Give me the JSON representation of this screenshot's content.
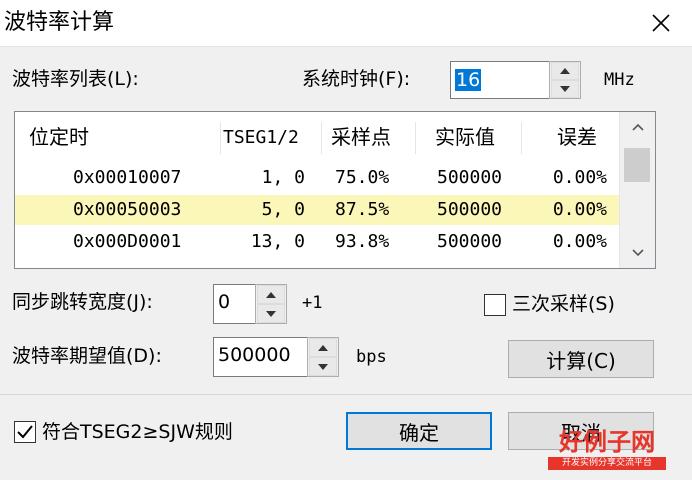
{
  "window": {
    "title": "波特率计算"
  },
  "list_label": "波特率列表(L):",
  "sysclock": {
    "label": "系统时钟(F):",
    "value": "16",
    "unit": "MHz"
  },
  "table": {
    "headers": [
      "位定时",
      "TSEG1/2",
      "采样点",
      "实际值",
      "误差"
    ],
    "rows": [
      {
        "timing": "0x00010007",
        "tseg": "1, 0",
        "sample": "75.0%",
        "actual": "500000",
        "error": "0.00%"
      },
      {
        "timing": "0x00050003",
        "tseg": "5, 0",
        "sample": "87.5%",
        "actual": "500000",
        "error": "0.00%"
      },
      {
        "timing": "0x000D0001",
        "tseg": "13, 0",
        "sample": "93.8%",
        "actual": "500000",
        "error": "0.00%"
      }
    ],
    "selected_index": 1
  },
  "sjw": {
    "label": "同步跳转宽度(J):",
    "value": "0",
    "suffix": "+1"
  },
  "triple_sample": {
    "label": "三次采样(S)",
    "checked": false
  },
  "baud": {
    "label": "波特率期望值(D):",
    "value": "500000",
    "unit": "bps"
  },
  "buttons": {
    "calc": "计算(C)",
    "ok": "确定",
    "cancel": "取消"
  },
  "rule_check": {
    "label": "符合TSEG2≥SJW规则",
    "checked": true
  },
  "logo": {
    "name": "好例子网",
    "tagline": "开发实例分享交流平台"
  },
  "colors": {
    "selected_row": "#fbf7b9",
    "default_button_border": "#0078d7",
    "input_selection": "#0078d7",
    "logo_red": "#e6352b"
  }
}
